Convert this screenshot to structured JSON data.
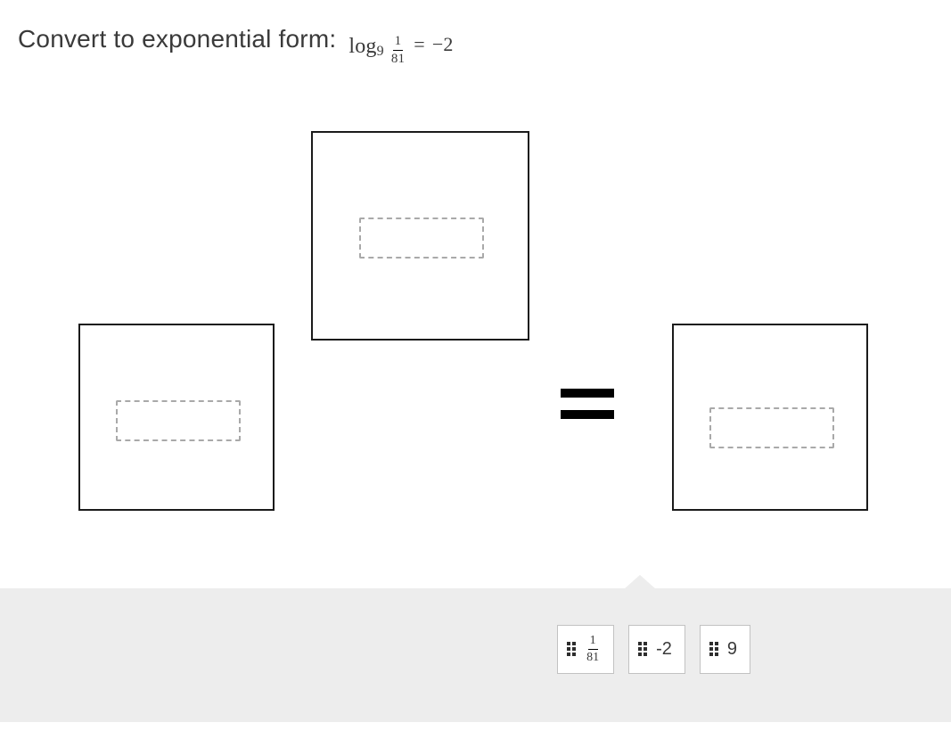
{
  "question": {
    "prefix": "Convert to exponential form:",
    "log_word": "log",
    "log_base": "9",
    "arg_num": "1",
    "arg_den": "81",
    "eq": "=",
    "rhs": "−2"
  },
  "equals_sign": "=",
  "drop_zones": {
    "base": "",
    "exponent": "",
    "result": ""
  },
  "tiles": [
    {
      "type": "fraction",
      "num": "1",
      "den": "81"
    },
    {
      "type": "text",
      "value": "-2"
    },
    {
      "type": "text",
      "value": "9"
    }
  ]
}
